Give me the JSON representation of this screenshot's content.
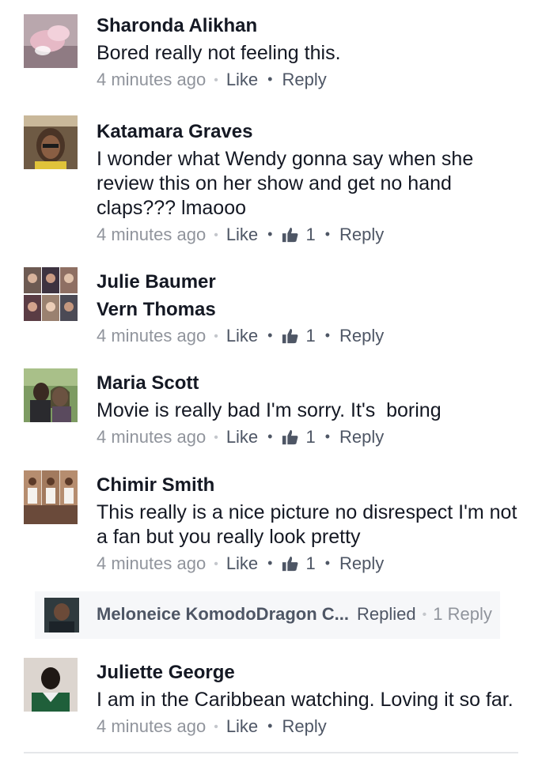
{
  "comments": [
    {
      "name": "Sharonda Alikhan",
      "text": "Bored really not feeling this.",
      "time": "4 minutes ago",
      "like_label": "Like",
      "reply_label": "Reply",
      "likes": ""
    },
    {
      "name": "Katamara Graves",
      "text": "I wonder what Wendy gonna say when she review this on her show and get no hand claps??? lmaooo",
      "time": "4 minutes ago",
      "like_label": "Like",
      "reply_label": "Reply",
      "likes": "1"
    },
    {
      "name": "Julie Baumer",
      "text": "Vern Thomas",
      "time": "4 minutes ago",
      "like_label": "Like",
      "reply_label": "Reply",
      "likes": "1"
    },
    {
      "name": "Maria Scott",
      "text": "Movie is really bad I'm sorry. It's  boring",
      "time": "4 minutes ago",
      "like_label": "Like",
      "reply_label": "Reply",
      "likes": "1"
    },
    {
      "name": "Chimir Smith",
      "text": "This really is a nice picture no disrespect I'm not a fan but you really look pretty",
      "time": "4 minutes ago",
      "like_label": "Like",
      "reply_label": "Reply",
      "likes": "1"
    },
    {
      "name": "Juliette George",
      "text": "I am in the Caribbean watching. Loving it so far.",
      "time": "4 minutes ago",
      "like_label": "Like",
      "reply_label": "Reply",
      "likes": ""
    }
  ],
  "reply_summary": {
    "name": "Meloneice KomodoDragon C...",
    "label": "Replied",
    "count": "1 Reply"
  },
  "colors": {
    "link": "#4e5665",
    "meta": "#90949c",
    "name": "#141823",
    "reply_bg": "#f6f7f9"
  },
  "icons": {
    "like": "thumbs-up-icon",
    "separator": "dot"
  }
}
